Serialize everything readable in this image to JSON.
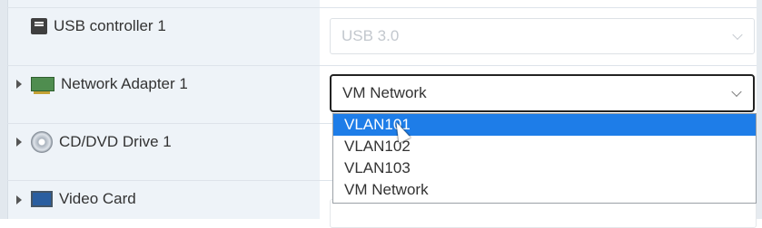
{
  "hardware": {
    "usb": {
      "label": "USB controller 1",
      "value": "USB 3.0",
      "icon": "usb-icon"
    },
    "network": {
      "label": "Network Adapter 1",
      "value": "VM Network",
      "icon": "network-card-icon"
    },
    "cddvd": {
      "label": "CD/DVD Drive 1",
      "icon": "cd-dvd-icon"
    },
    "video": {
      "label": "Video Card",
      "icon": "video-card-icon"
    }
  },
  "dropdown": {
    "options": [
      "VLAN101",
      "VLAN102",
      "VLAN103",
      "VM Network"
    ],
    "highlighted": "VLAN101"
  },
  "colors": {
    "highlight": "#1e7de8",
    "left_panel": "#eef3f8"
  }
}
